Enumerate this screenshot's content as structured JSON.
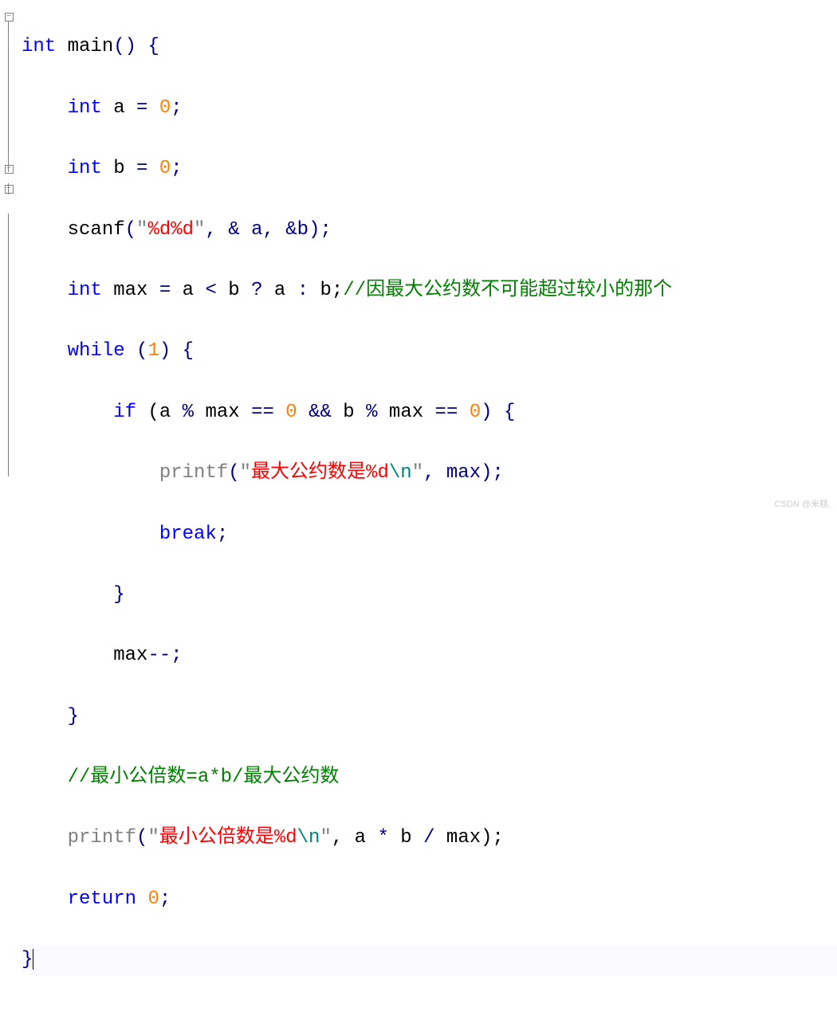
{
  "gutter": {
    "fold_markers": [
      "−",
      "−",
      "−"
    ]
  },
  "code": {
    "l1": {
      "a": "int",
      "b": " main",
      "c": "() {"
    },
    "l2": {
      "a": "int",
      "b": " a ",
      "c": "=",
      "d": " ",
      "e": "0",
      "f": ";"
    },
    "l3": {
      "a": "int",
      "b": " b ",
      "c": "=",
      "d": " ",
      "e": "0",
      "f": ";"
    },
    "l4": {
      "a": "scanf",
      "b": "(",
      "c": "\"",
      "d": "%d%d",
      "e": "\"",
      "f": ", & a, &b);"
    },
    "l5": {
      "a": "int",
      "b": " max ",
      "c": "=",
      "d": " a ",
      "e": "<",
      "f": " b ",
      "g": "?",
      "h": " a ",
      "i": ":",
      "j": " b;",
      "k": "//因最大公约数不可能超过较小的那个"
    },
    "l6": {
      "a": "while",
      "b": " (",
      "c": "1",
      "d": ") {"
    },
    "l7": {
      "a": "if",
      "b": " (a ",
      "c": "%",
      "d": " max ",
      "e": "==",
      "f": " ",
      "g": "0",
      "h": " ",
      "i": "&&",
      "j": " b ",
      "k": "%",
      "l": " max ",
      "m": "==",
      "n": " ",
      "o": "0",
      "p": ") {"
    },
    "l8": {
      "a": "printf",
      "b": "(",
      "c": "\"",
      "d": "最大公约数是%d",
      "e": "\\n",
      "f": "\"",
      "g": ", max);"
    },
    "l9": {
      "a": "break",
      "b": ";"
    },
    "l10": {
      "a": "}"
    },
    "l11": {
      "a": "max",
      "b": "--",
      ";": ";"
    },
    "l12": {
      "a": "}"
    },
    "l13": {
      "a": "//最小公倍数=a*b/最大公约数"
    },
    "l14": {
      "a": "printf",
      "b": "(",
      "c": "\"",
      "d": "最小公倍数是%d",
      "e": "\\n",
      "f": "\"",
      "g": ", a ",
      "h": "*",
      "i": " b ",
      "j": "/",
      "k": " max);"
    },
    "l15": {
      "a": "return",
      "b": " ",
      "c": "0",
      "d": ";"
    },
    "l16": {
      "a": "}"
    }
  },
  "watermark": "CSDN @米糕."
}
